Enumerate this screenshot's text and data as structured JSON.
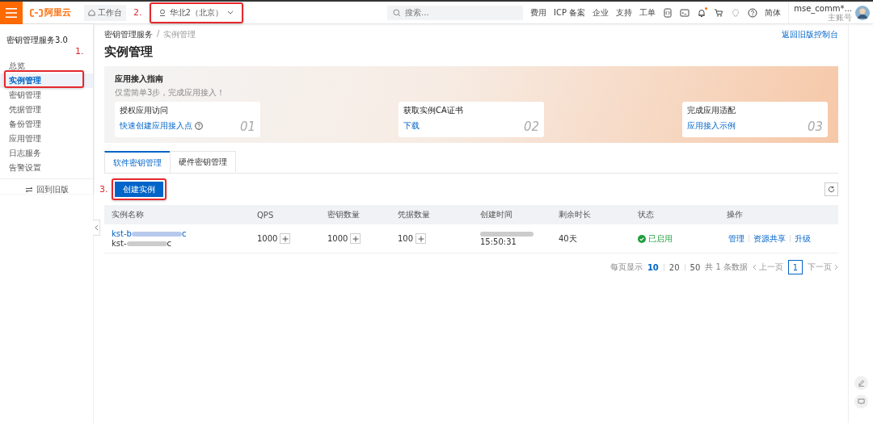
{
  "topbar": {
    "logo": "阿里云",
    "workbench": "工作台",
    "region": "华北2（北京）",
    "search_placeholder": "搜索...",
    "links": [
      "费用",
      "ICP 备案",
      "企业",
      "支持",
      "工单"
    ],
    "notification_dot": true,
    "language": "简体",
    "account": {
      "name": "mse_comm*...",
      "role": "主账号"
    }
  },
  "sidebar": {
    "title": "密钥管理服务3.0",
    "items": [
      {
        "label": "总览",
        "selected": false
      },
      {
        "label": "实例管理",
        "selected": true
      },
      {
        "label": "密钥管理",
        "selected": false
      },
      {
        "label": "凭据管理",
        "selected": false
      },
      {
        "label": "备份管理",
        "selected": false
      },
      {
        "label": "应用管理",
        "selected": false
      },
      {
        "label": "日志服务",
        "selected": false
      },
      {
        "label": "告警设置",
        "selected": false
      }
    ],
    "footer": "回到旧版"
  },
  "breadcrumb": [
    "密钥管理服务",
    "实例管理"
  ],
  "breadcrumb_separator": "/",
  "back_link": "返回旧版控制台",
  "page_title": "实例管理",
  "guide": {
    "title": "应用接入指南",
    "subtitle": "仅需简单3步，完成应用接入！",
    "steps": [
      {
        "title": "授权应用访问",
        "link": "快速创建应用接入点",
        "help": true,
        "number": "01"
      },
      {
        "title": "获取实例CA证书",
        "link": "下载",
        "help": false,
        "number": "02"
      },
      {
        "title": "完成应用适配",
        "link": "应用接入示例",
        "help": false,
        "number": "03"
      }
    ]
  },
  "tabs": [
    {
      "label": "软件密钥管理",
      "selected": true
    },
    {
      "label": "硬件密钥管理",
      "selected": false
    }
  ],
  "create_button": "创建实例",
  "table": {
    "columns": [
      "实例名称",
      "QPS",
      "密钥数量",
      "凭据数量",
      "创建时间",
      "剩余时长",
      "状态",
      "操作"
    ],
    "rows": [
      {
        "name_start": "kst-b",
        "name_end": "c",
        "sub_start": "kst-",
        "sub_end": "c",
        "qps": "1000",
        "key_count": "1000",
        "credential_count": "100",
        "created_time": "15:50:31",
        "remaining": "40天",
        "status": "已启用",
        "actions": [
          "管理",
          "资源共享",
          "升级"
        ]
      }
    ]
  },
  "pagination": {
    "page_size_label": "每页显示",
    "page_sizes": [
      {
        "label": "10",
        "selected": true
      },
      {
        "label": "20",
        "selected": false
      },
      {
        "label": "50",
        "selected": false
      }
    ],
    "total": "共 1 条数据",
    "prev": "上一页",
    "pages": [
      {
        "label": "1",
        "selected": true
      }
    ],
    "next": "下一页"
  },
  "annotations": [
    {
      "label": "1."
    },
    {
      "label": "2."
    },
    {
      "label": "3."
    }
  ]
}
